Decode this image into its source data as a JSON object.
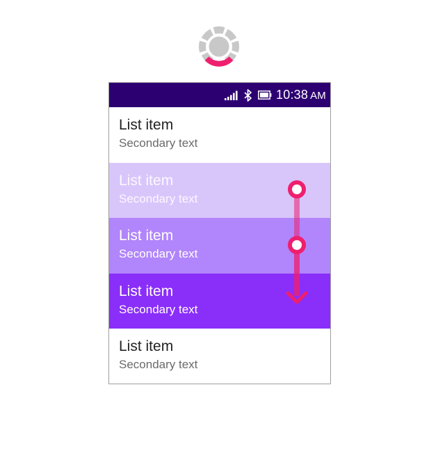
{
  "status_bar": {
    "time": "10:38",
    "ampm": "AM",
    "icons": [
      "signal-icon",
      "bluetooth-icon",
      "battery-icon"
    ]
  },
  "list": {
    "items": [
      {
        "primary": "List item",
        "secondary": "Secondary text",
        "state": "default"
      },
      {
        "primary": "List item",
        "secondary": "Secondary text",
        "state": "pressed-light"
      },
      {
        "primary": "List item",
        "secondary": "Secondary text",
        "state": "pressed-medium"
      },
      {
        "primary": "List item",
        "secondary": "Secondary text",
        "state": "focused"
      },
      {
        "primary": "List item",
        "secondary": "Secondary text",
        "state": "default"
      }
    ]
  },
  "colors": {
    "status_bar_bg": "#2d0072",
    "item_light": "#d8c6fb",
    "item_medium": "#b185fb",
    "item_focused": "#8a2efa",
    "gesture_accent": "#ef1f6f",
    "dpad_gray": "#c8c8c8"
  },
  "gesture": {
    "type": "swipe-down",
    "icons": [
      "touch-point-icon",
      "touch-point-icon",
      "arrow-down-icon"
    ]
  }
}
